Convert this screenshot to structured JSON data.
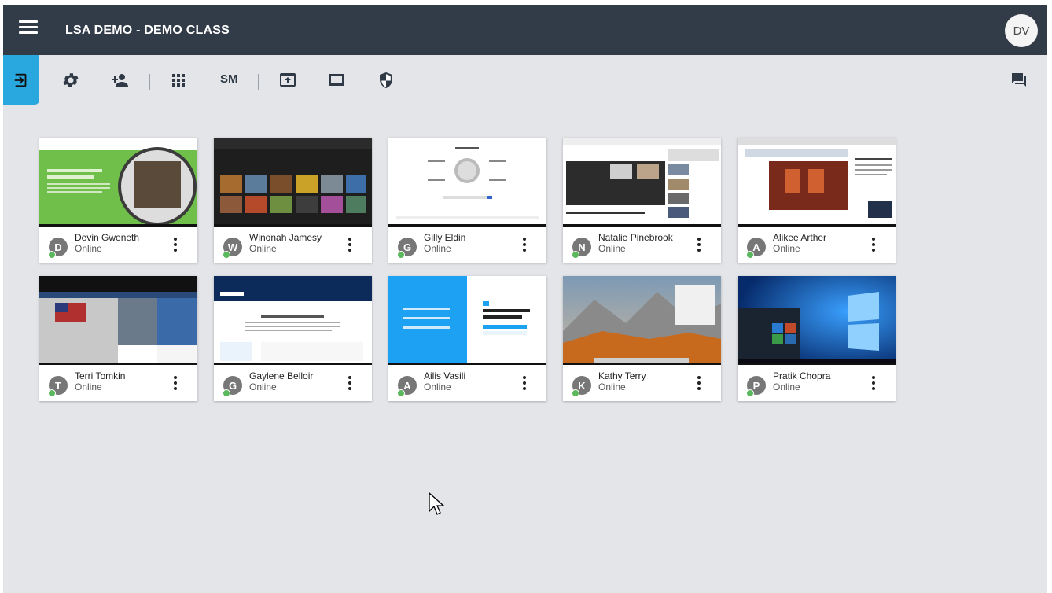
{
  "header": {
    "title": "LSA DEMO - DEMO CLASS",
    "user_initials": "DV"
  },
  "toolbar": {
    "icons": [
      "exit-class-icon",
      "settings-gear-icon",
      "add-student-icon",
      "grid-view-icon",
      "show-messages-icon",
      "share-screen-icon",
      "view-screen-icon",
      "safety-shield-icon",
      "chat-icon"
    ],
    "sm_label": "SM"
  },
  "students": [
    {
      "initial": "D",
      "name": "Devin Gweneth",
      "status": "Online"
    },
    {
      "initial": "W",
      "name": "Winonah Jamesy",
      "status": "Online"
    },
    {
      "initial": "G",
      "name": "Gilly Eldin",
      "status": "Online"
    },
    {
      "initial": "N",
      "name": "Natalie Pinebrook",
      "status": "Online"
    },
    {
      "initial": "A",
      "name": "Alikee Arther",
      "status": "Online"
    },
    {
      "initial": "T",
      "name": "Terri Tomkin",
      "status": "Online"
    },
    {
      "initial": "G",
      "name": "Gaylene Belloir",
      "status": "Online"
    },
    {
      "initial": "A",
      "name": "Ailis Vasili",
      "status": "Online"
    },
    {
      "initial": "K",
      "name": "Kathy Terry",
      "status": "Online"
    },
    {
      "initial": "P",
      "name": "Pratik Chopra",
      "status": "Online"
    }
  ],
  "colors": {
    "header_bg": "#323c48",
    "accent": "#29a8df",
    "online": "#5cb85c",
    "canvas": "#e3e5e8"
  }
}
